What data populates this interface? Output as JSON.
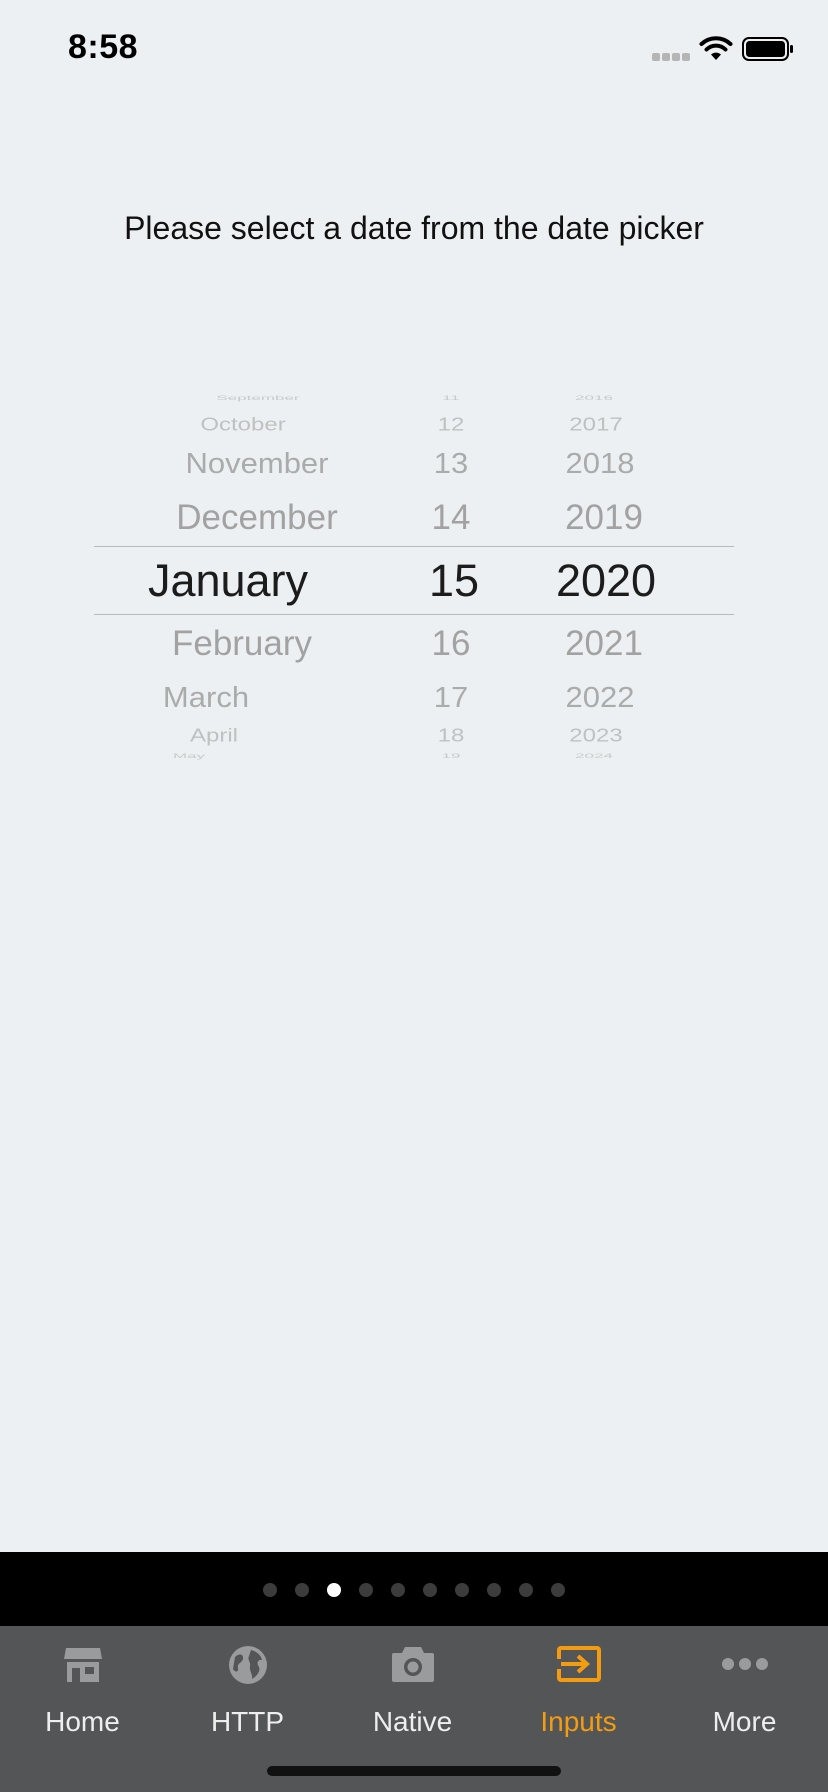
{
  "status_bar": {
    "time": "8:58"
  },
  "prompt": "Please select a date from the date picker",
  "picker": {
    "months": [
      "September",
      "October",
      "November",
      "December",
      "January",
      "February",
      "March",
      "April",
      "May"
    ],
    "days": [
      "11",
      "12",
      "13",
      "14",
      "15",
      "16",
      "17",
      "18",
      "19"
    ],
    "years": [
      "2016",
      "2017",
      "2018",
      "2019",
      "2020",
      "2021",
      "2022",
      "2023",
      "2024"
    ],
    "selected": {
      "month": "January",
      "day": "15",
      "year": "2020"
    }
  },
  "page_indicator": {
    "count": 10,
    "active_index": 2
  },
  "tabs": [
    {
      "label": "Home",
      "icon": "store-icon"
    },
    {
      "label": "HTTP",
      "icon": "globe-icon"
    },
    {
      "label": "Native",
      "icon": "camera-icon"
    },
    {
      "label": "Inputs",
      "icon": "input-icon",
      "active": true
    },
    {
      "label": "More",
      "icon": "more-icon"
    }
  ],
  "colors": {
    "accent": "#f39c12",
    "tab_bar": "#545557",
    "background": "#edf0f2"
  }
}
